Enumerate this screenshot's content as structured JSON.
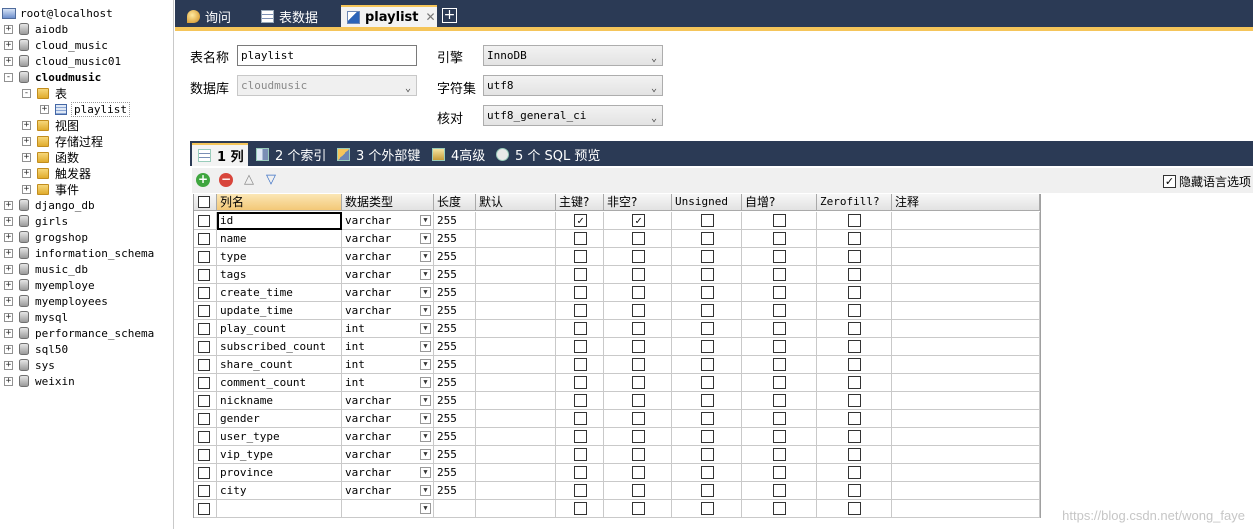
{
  "tree": {
    "server": "root@localhost",
    "items": [
      {
        "label": "aiodb",
        "kind": "db",
        "exp": "+",
        "indent": 0
      },
      {
        "label": "cloud_music",
        "kind": "db",
        "exp": "+",
        "indent": 0
      },
      {
        "label": "cloud_music01",
        "kind": "db",
        "exp": "+",
        "indent": 0
      },
      {
        "label": "cloudmusic",
        "kind": "db",
        "exp": "-",
        "indent": 0,
        "bold": true
      },
      {
        "label": "表",
        "kind": "folder",
        "exp": "-",
        "indent": 1
      },
      {
        "label": "playlist",
        "kind": "table",
        "exp": "+",
        "indent": 2,
        "selected": true
      },
      {
        "label": "视图",
        "kind": "folder",
        "exp": "+",
        "indent": 1
      },
      {
        "label": "存储过程",
        "kind": "folder",
        "exp": "+",
        "indent": 1
      },
      {
        "label": "函数",
        "kind": "folder",
        "exp": "+",
        "indent": 1
      },
      {
        "label": "触发器",
        "kind": "folder",
        "exp": "+",
        "indent": 1
      },
      {
        "label": "事件",
        "kind": "folder",
        "exp": "+",
        "indent": 1
      },
      {
        "label": "django_db",
        "kind": "db",
        "exp": "+",
        "indent": 0
      },
      {
        "label": "girls",
        "kind": "db",
        "exp": "+",
        "indent": 0
      },
      {
        "label": "grogshop",
        "kind": "db",
        "exp": "+",
        "indent": 0
      },
      {
        "label": "information_schema",
        "kind": "db",
        "exp": "+",
        "indent": 0
      },
      {
        "label": "music_db",
        "kind": "db",
        "exp": "+",
        "indent": 0
      },
      {
        "label": "myemploye",
        "kind": "db",
        "exp": "+",
        "indent": 0
      },
      {
        "label": "myemployees",
        "kind": "db",
        "exp": "+",
        "indent": 0
      },
      {
        "label": "mysql",
        "kind": "db",
        "exp": "+",
        "indent": 0
      },
      {
        "label": "performance_schema",
        "kind": "db",
        "exp": "+",
        "indent": 0
      },
      {
        "label": "sql50",
        "kind": "db",
        "exp": "+",
        "indent": 0
      },
      {
        "label": "sys",
        "kind": "db",
        "exp": "+",
        "indent": 0
      },
      {
        "label": "weixin",
        "kind": "db",
        "exp": "+",
        "indent": 0
      }
    ]
  },
  "tabs": {
    "query": "询问",
    "data": "表数据",
    "design": "playlist",
    "close": "✕",
    "add": "+"
  },
  "form": {
    "table_name_label": "表名称",
    "table_name_value": "playlist",
    "database_label": "数据库",
    "database_value": "cloudmusic",
    "engine_label": "引擎",
    "engine_value": "InnoDB",
    "charset_label": "字符集",
    "charset_value": "utf8",
    "collation_label": "核对",
    "collation_value": "utf8_general_ci"
  },
  "subtabs": {
    "columns": "1 列",
    "indexes": "2 个索引",
    "foreign_keys": "3 个外部键",
    "advanced": "4高级",
    "sql_preview": "5 个 SQL 预览"
  },
  "toolbar": {
    "hide_language_options": "隐藏语言选项",
    "hide_language_checked": true
  },
  "grid": {
    "headers": {
      "name": "列名",
      "type": "数据类型",
      "length": "长度",
      "default": "默认",
      "pk": "主键?",
      "not_null": "非空?",
      "unsigned": "Unsigned",
      "auto_inc": "自增?",
      "zerofill": "Zerofill?",
      "comment": "注释"
    },
    "rows": [
      {
        "name": "id",
        "type": "varchar",
        "length": "255",
        "pk": true,
        "nn": true
      },
      {
        "name": "name",
        "type": "varchar",
        "length": "255",
        "pk": false,
        "nn": false
      },
      {
        "name": "type",
        "type": "varchar",
        "length": "255",
        "pk": false,
        "nn": false
      },
      {
        "name": "tags",
        "type": "varchar",
        "length": "255",
        "pk": false,
        "nn": false
      },
      {
        "name": "create_time",
        "type": "varchar",
        "length": "255",
        "pk": false,
        "nn": false
      },
      {
        "name": "update_time",
        "type": "varchar",
        "length": "255",
        "pk": false,
        "nn": false
      },
      {
        "name": "play_count",
        "type": "int",
        "length": "255",
        "pk": false,
        "nn": false
      },
      {
        "name": "subscribed_count",
        "type": "int",
        "length": "255",
        "pk": false,
        "nn": false
      },
      {
        "name": "share_count",
        "type": "int",
        "length": "255",
        "pk": false,
        "nn": false
      },
      {
        "name": "comment_count",
        "type": "int",
        "length": "255",
        "pk": false,
        "nn": false
      },
      {
        "name": "nickname",
        "type": "varchar",
        "length": "255",
        "pk": false,
        "nn": false
      },
      {
        "name": "gender",
        "type": "varchar",
        "length": "255",
        "pk": false,
        "nn": false
      },
      {
        "name": "user_type",
        "type": "varchar",
        "length": "255",
        "pk": false,
        "nn": false
      },
      {
        "name": "vip_type",
        "type": "varchar",
        "length": "255",
        "pk": false,
        "nn": false
      },
      {
        "name": "province",
        "type": "varchar",
        "length": "255",
        "pk": false,
        "nn": false
      },
      {
        "name": "city",
        "type": "varchar",
        "length": "255",
        "pk": false,
        "nn": false
      },
      {
        "name": "",
        "type": "",
        "length": "",
        "pk": false,
        "nn": false
      }
    ]
  },
  "watermark": "https://blog.csdn.net/wong_faye",
  "colors": {
    "nav_dark": "#2b3a55",
    "accent": "#f5c55a"
  }
}
